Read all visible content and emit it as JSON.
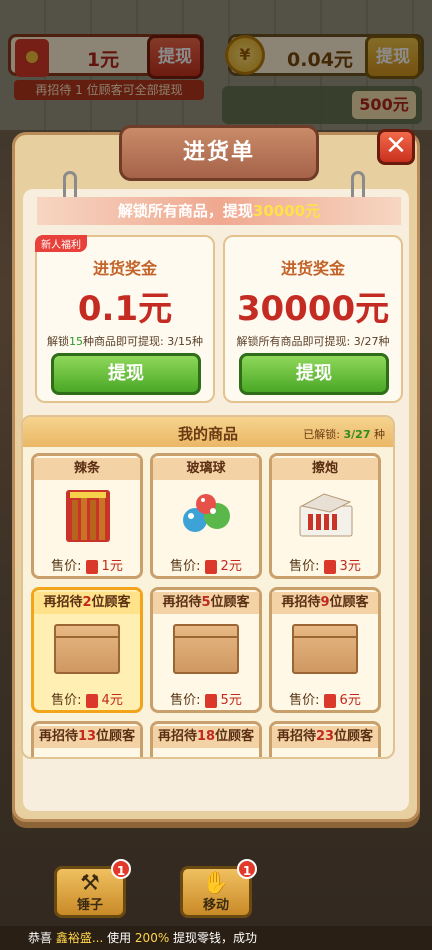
{
  "top": {
    "cash_value": "1元",
    "cash_withdraw": "提现",
    "coin_icon": "¥",
    "coin_value": "0.04元",
    "coin_withdraw": "提现",
    "tip": "再招待 1 位顾客可全部提现",
    "side_amount": "500元"
  },
  "panel": {
    "title": "进货单",
    "close_icon": "close-icon",
    "banner_prefix": "解锁所有商品，提现",
    "banner_amount": "30000元"
  },
  "awards": [
    {
      "tag": "新人福利",
      "title": "进货奖金",
      "amount": "0.1元",
      "progress_a": "解锁",
      "progress_n": "15",
      "progress_b": "种商品即可提现: 3/15种",
      "button": "提现"
    },
    {
      "tag": "",
      "title": "进货奖金",
      "amount": "30000元",
      "progress_a": "解锁所有商品即可提现: 3/27种",
      "progress_n": "",
      "progress_b": "",
      "button": "提现"
    }
  ],
  "goods": {
    "title": "我的商品",
    "unlock_label": "已解锁:",
    "unlock_count": "3/27",
    "unlock_unit": "种",
    "price_label": "售价:",
    "items": [
      {
        "name": "辣条",
        "price": "1元"
      },
      {
        "name": "玻璃球",
        "price": "2元"
      },
      {
        "name": "擦炮",
        "price": "3元"
      },
      {
        "name_a": "再招待",
        "n": "2",
        "name_b": "位顾客",
        "price": "4元"
      },
      {
        "name_a": "再招待",
        "n": "5",
        "name_b": "位顾客",
        "price": "5元"
      },
      {
        "name_a": "再招待",
        "n": "9",
        "name_b": "位顾客",
        "price": "6元"
      },
      {
        "name_a": "再招待",
        "n": "13",
        "name_b": "位顾客"
      },
      {
        "name_a": "再招待",
        "n": "18",
        "name_b": "位顾客"
      },
      {
        "name_a": "再招待",
        "n": "23",
        "name_b": "位顾客"
      }
    ]
  },
  "bottom": {
    "hammer_label": "锤子",
    "hammer_badge": "1",
    "move_label": "移动",
    "move_badge": "1"
  },
  "ticker": {
    "a": "恭喜 ",
    "name": "鑫裕盛...",
    "b": " 使用 ",
    "pct": "200%",
    "c": " 提现零钱，成功"
  }
}
